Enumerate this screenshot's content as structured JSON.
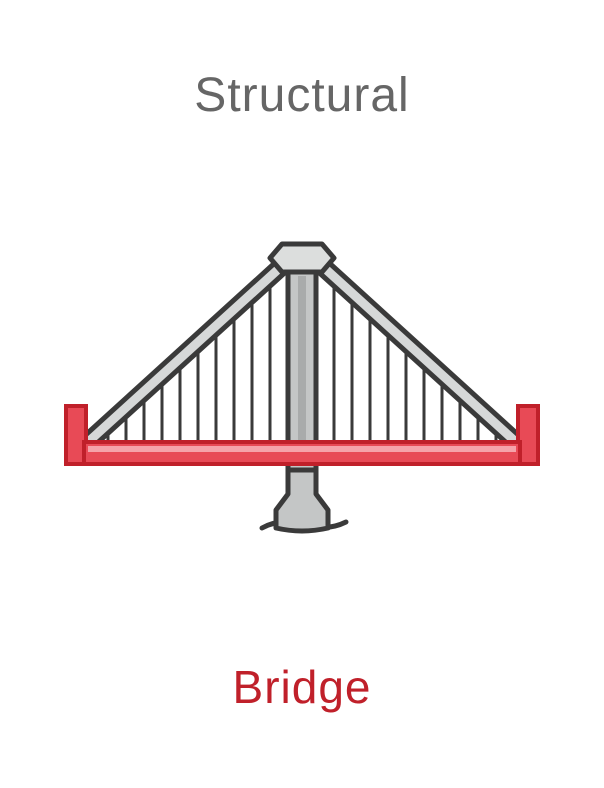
{
  "header": {
    "category": "Structural"
  },
  "illustration": {
    "icon": "bridge-icon"
  },
  "footer": {
    "label": "Bridge"
  },
  "colors": {
    "label": "#c0202a",
    "category": "#666666",
    "outline": "#3a3a3a",
    "deck_fill": "#e84a56",
    "deck_highlight": "#f5a3aa",
    "tower_fill": "#c4c6c6",
    "cable_fill": "#d6d8d8"
  }
}
